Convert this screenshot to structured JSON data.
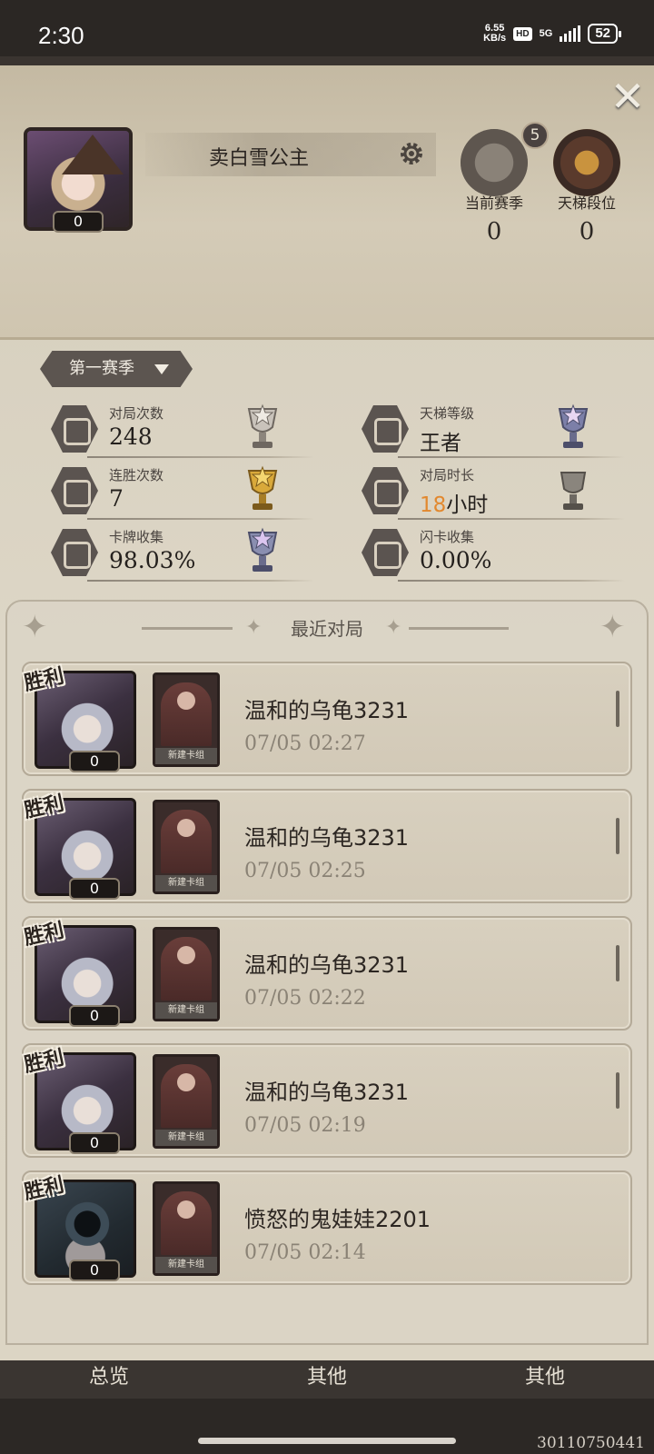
{
  "status_bar": {
    "time": "2:30",
    "speed_value": "6.55",
    "speed_unit": "KB/s",
    "hd": "HD",
    "network": "5G",
    "battery": "52"
  },
  "profile": {
    "name": "卖白雪公主",
    "level": "0",
    "crown_count": "5",
    "current_season_label": "当前赛季",
    "current_season_value": "0",
    "ladder_rank_label": "天梯段位",
    "ladder_rank_value": "0"
  },
  "season_selector": {
    "label": "第一赛季"
  },
  "stats": [
    {
      "label": "对局次数",
      "value": "248"
    },
    {
      "label": "天梯等级",
      "value": "王者"
    },
    {
      "label": "连胜次数",
      "value": "7"
    },
    {
      "label": "对局时长",
      "value_number": "18",
      "value_unit": "小时"
    },
    {
      "label": "卡牌收集",
      "value": "98.03%"
    },
    {
      "label": "闪卡收集",
      "value": "0.00%"
    }
  ],
  "recent": {
    "title": "最近对局",
    "matches": [
      {
        "result": "胜利",
        "level": "0",
        "deck": "新建卡组",
        "opponent": "温和的乌龟3231",
        "time": "07/05 02:27"
      },
      {
        "result": "胜利",
        "level": "0",
        "deck": "新建卡组",
        "opponent": "温和的乌龟3231",
        "time": "07/05 02:25"
      },
      {
        "result": "胜利",
        "level": "0",
        "deck": "新建卡组",
        "opponent": "温和的乌龟3231",
        "time": "07/05 02:22"
      },
      {
        "result": "胜利",
        "level": "0",
        "deck": "新建卡组",
        "opponent": "温和的乌龟3231",
        "time": "07/05 02:19"
      },
      {
        "result": "胜利",
        "level": "0",
        "deck": "新建卡组",
        "opponent": "愤怒的鬼娃娃2201",
        "time": "07/05 02:14"
      }
    ]
  },
  "tabs": [
    "总览",
    "其他",
    "其他"
  ],
  "uid": "30110750441"
}
